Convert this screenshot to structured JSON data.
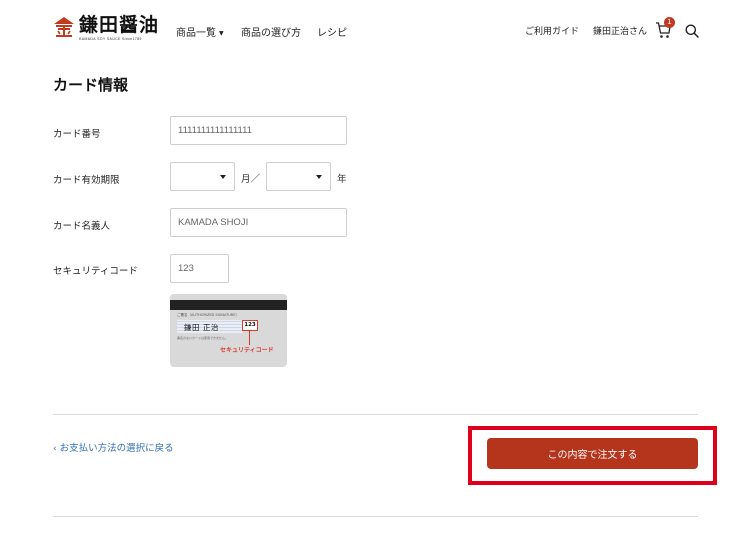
{
  "header": {
    "logo_title": "鎌田醤油",
    "logo_subtitle": "KAMADA SOY SAUCE Since1789",
    "logo_mark_text": "金",
    "nav": [
      {
        "label": "商品一覧",
        "has_dropdown": true
      },
      {
        "label": "商品の選び方",
        "has_dropdown": false
      },
      {
        "label": "レシピ",
        "has_dropdown": false
      }
    ],
    "guide_label": "ご利用ガイド",
    "user_label": "鎌田正治さん",
    "cart_count": "1",
    "icons": {
      "cart": "cart-icon",
      "search": "search-icon"
    }
  },
  "card_form": {
    "title": "カード情報",
    "card_number": {
      "label": "カード番号",
      "value": "1111111111111111"
    },
    "expiry": {
      "label": "カード有効期限",
      "month_unit": "月／",
      "year_unit": "年",
      "month_value": "",
      "year_value": ""
    },
    "holder": {
      "label": "カード名義人",
      "value": "KAMADA SHOJI"
    },
    "security": {
      "label": "セキュリティコード",
      "value": "123"
    },
    "card_image": {
      "signature_caption": "ご署名（AUTHORIZED SIGNATURE）",
      "signature_name": "鎌田 正治",
      "cvv": "123",
      "note": "署名のないカードは使用できません。",
      "cvv_caption": "セキュリティコード"
    }
  },
  "actions": {
    "back_label": "お支払い方法の選択に戻る",
    "submit_label": "この内容で注文する"
  },
  "colors": {
    "accent": "#b5341c",
    "highlight": "#e0001b",
    "link": "#2f6fb3",
    "badge": "#c23a1f"
  }
}
